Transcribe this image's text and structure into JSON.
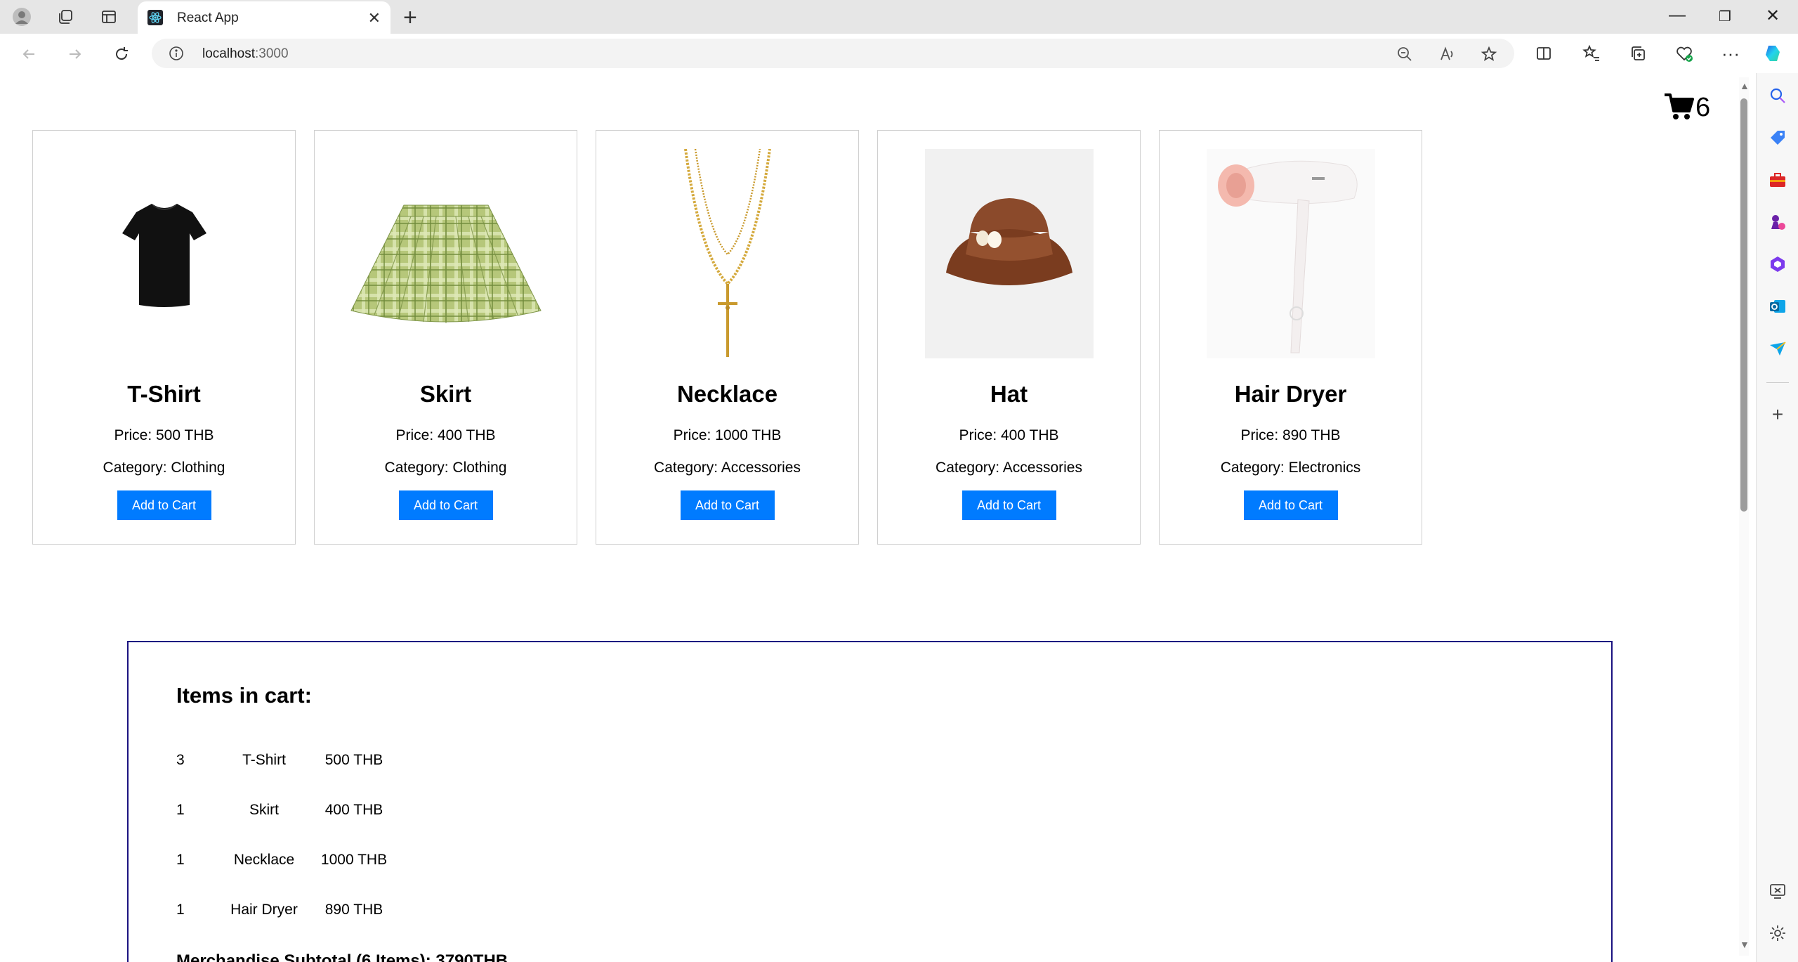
{
  "browser": {
    "tab_title": "React App",
    "url_host": "localhost",
    "url_port": ":3000"
  },
  "cart_icon": {
    "count": "6"
  },
  "products": [
    {
      "name": "T-Shirt",
      "price": "Price: 500 THB",
      "category": "Category: Clothing",
      "button": "Add to Cart",
      "image": "tshirt-image"
    },
    {
      "name": "Skirt",
      "price": "Price: 400 THB",
      "category": "Category: Clothing",
      "button": "Add to Cart",
      "image": "skirt-image"
    },
    {
      "name": "Necklace",
      "price": "Price: 1000 THB",
      "category": "Category: Accessories",
      "button": "Add to Cart",
      "image": "necklace-image"
    },
    {
      "name": "Hat",
      "price": "Price: 400 THB",
      "category": "Category: Accessories",
      "button": "Add to Cart",
      "image": "hat-image"
    },
    {
      "name": "Hair Dryer",
      "price": "Price: 890 THB",
      "category": "Category: Electronics",
      "button": "Add to Cart",
      "image": "hair-dryer-image"
    }
  ],
  "cart": {
    "heading": "Items in cart:",
    "items": [
      {
        "qty": "3",
        "name": "T-Shirt",
        "price": "500 THB"
      },
      {
        "qty": "1",
        "name": "Skirt",
        "price": "400 THB"
      },
      {
        "qty": "1",
        "name": "Necklace",
        "price": "1000 THB"
      },
      {
        "qty": "1",
        "name": "Hair Dryer",
        "price": "890 THB"
      }
    ],
    "subtotal": "Merchandise Subtotal (6 Items):     3790THB"
  },
  "colors": {
    "accent": "#007bff",
    "cart_border": "#1a1280"
  }
}
